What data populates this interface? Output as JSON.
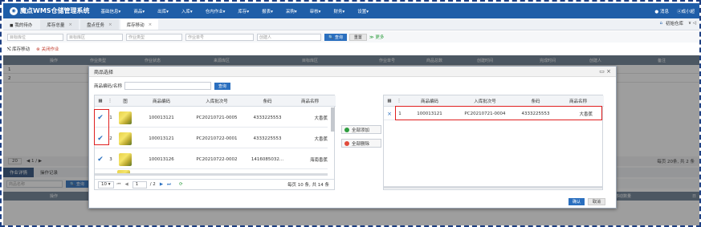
{
  "app": {
    "logo_text": "魔点WMS仓储管理系统",
    "menu": [
      "基础信息▾",
      "商品▾",
      "出库▾",
      "入库▾",
      "仓内作业▾",
      "库存▾",
      "报表▾",
      "采购▾",
      "审核▾",
      "财务▾",
      "设置▾"
    ],
    "messages": "● 消息",
    "user": "ⓐ成小超",
    "warehouse": "初始仓库",
    "warehouse_caret": "∨ ◁"
  },
  "tabs": [
    {
      "label": "◼ 我的待办",
      "closable": false
    },
    {
      "label": "库存总量",
      "closable": true
    },
    {
      "label": "盘点任务",
      "closable": true
    },
    {
      "label": "库存移动",
      "closable": true
    }
  ],
  "tab_close": "×",
  "filter": {
    "f1": "目标库位",
    "f2": "目标库区",
    "f3": "作业类型",
    "f4": "作业单号",
    "f5": "创建人",
    "search": "🔍 查询",
    "reset": "重置",
    "more": "≫ 更多"
  },
  "actions": {
    "move": "⤭ 库存移动",
    "close": "⊗ 关闭作业"
  },
  "bg_headers": [
    "操作",
    "作业类型",
    "作业状态",
    "来源库区",
    "目标库区",
    "作业单号",
    "商品总数",
    "创建时间",
    "完成时间",
    "创建人",
    "备注"
  ],
  "bg_rows": [
    "1",
    "2"
  ],
  "bg_pager": {
    "size": "20",
    "info": "每页 20条, 共 2 条",
    "nav": "◀  1  /  ▶"
  },
  "bg_tabs": [
    "作业详情",
    "操作记录"
  ],
  "bg_filter2": {
    "field": "商品名称",
    "search": "🔍 查询"
  },
  "bg_table2": {
    "op": "操作",
    "qty": "移动数量",
    "right": "日"
  },
  "dialog": {
    "title": "商品选择",
    "controls": "▭ ×",
    "search_label": "商品编码/名称",
    "search_button": "查询",
    "left_headers": {
      "grid": "▦",
      "more": "⋮",
      "img": "图",
      "code": "商品编码",
      "batch": "入库批次号",
      "barcode": "条码",
      "name": "商品名称"
    },
    "left_rows": [
      {
        "checked": true,
        "no": "1",
        "code": "100013121",
        "batch": "PC20210721-0005",
        "barcode": "4333225553",
        "name": "大香蕉"
      },
      {
        "checked": true,
        "no": "2",
        "code": "100013121",
        "batch": "PC20210722-0001",
        "barcode": "4333225553",
        "name": "大香蕉"
      },
      {
        "checked": true,
        "no": "3",
        "code": "100013126",
        "batch": "PC20210722-0002",
        "barcode": "1416085032...",
        "name": "海南香蕉"
      }
    ],
    "left_pager": {
      "size": "10",
      "page": "1",
      "total_pages": "/ 2",
      "info": "每页 10 条, 共 14 条"
    },
    "add_all": "全部添加",
    "remove_all": "全部删除",
    "right_headers": {
      "grid": "▦",
      "more": "⋮",
      "code": "商品编码",
      "batch": "入库批次号",
      "barcode": "条码",
      "name": "商品名称"
    },
    "right_rows": [
      {
        "remove": "×",
        "no": "1",
        "code": "100013121",
        "batch": "PC20210721-0004",
        "barcode": "4333225553",
        "name": "大香蕉"
      }
    ],
    "confirm": "确认",
    "cancel": "取消"
  },
  "colors": {
    "nav": "#1f5ea8",
    "primary": "#2a6fbf",
    "highlight": "#e02020",
    "add": "#2e9d3f",
    "delete": "#e14b3b"
  }
}
